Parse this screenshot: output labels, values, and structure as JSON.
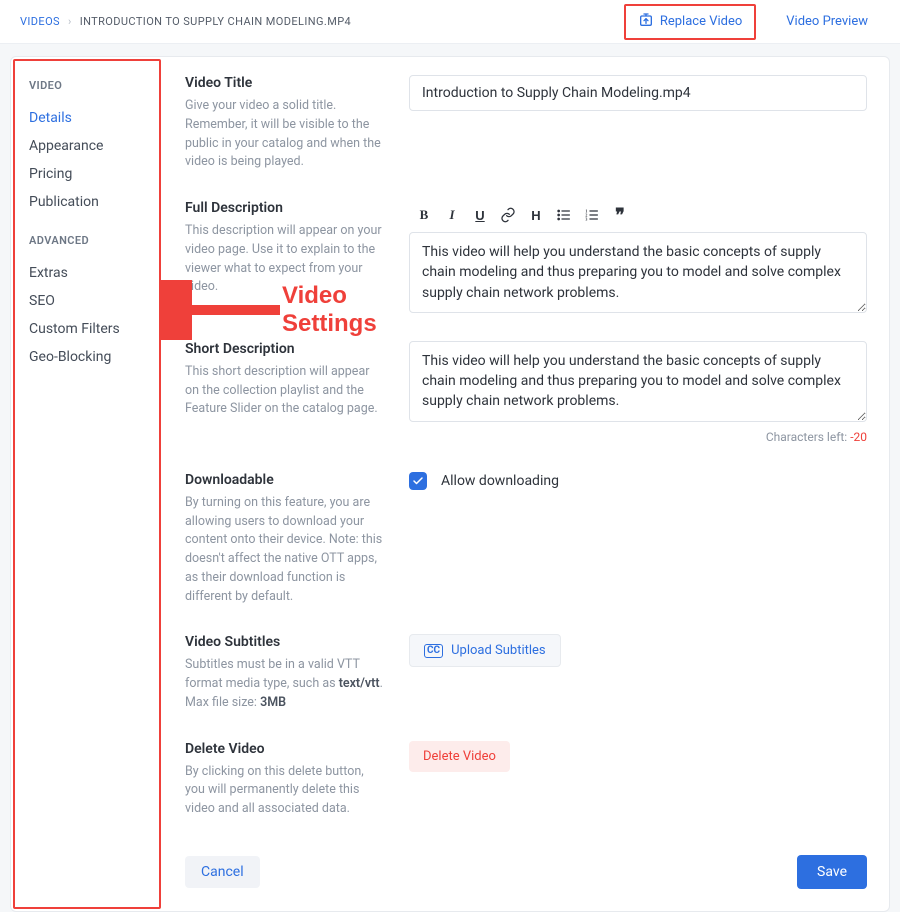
{
  "breadcrumb": {
    "root": "VIDEOS",
    "sep": "›",
    "current": "INTRODUCTION TO SUPPLY CHAIN MODELING.MP4"
  },
  "topbar": {
    "replace_label": "Replace Video",
    "preview_label": "Video Preview"
  },
  "sidebar": {
    "video_section": "VIDEO",
    "advanced_section": "ADVANCED",
    "items_video": [
      "Details",
      "Appearance",
      "Pricing",
      "Publication"
    ],
    "items_advanced": [
      "Extras",
      "SEO",
      "Custom Filters",
      "Geo-Blocking"
    ]
  },
  "annotation": {
    "label_line1": "Video",
    "label_line2": "Settings"
  },
  "fields": {
    "title": {
      "label": "Video Title",
      "desc": "Give your video a solid title. Remember, it will be visible to the public in your catalog and when the video is being played.",
      "value": "Introduction to Supply Chain Modeling.mp4"
    },
    "full_desc": {
      "label": "Full Description",
      "desc": "This description will appear on your video page. Use it to explain to the viewer what to expect from your video.",
      "value": "This video will help you understand the basic concepts of supply chain modeling and thus preparing you to model and solve complex supply chain network problems."
    },
    "short_desc": {
      "label": "Short Description",
      "desc": "This short description will appear on the collection playlist and the Feature Slider on the catalog page.",
      "value": "This video will help you understand the basic concepts of supply chain modeling and thus preparing you to model and solve complex supply chain network problems.",
      "chars_left_label": "Characters left: ",
      "chars_left_value": "-20"
    },
    "downloadable": {
      "label": "Downloadable",
      "desc": "By turning on this feature, you are allowing users to download your content onto their device. Note: this doesn't affect the native OTT apps, as their download function is different by default.",
      "checkbox_label": "Allow downloading",
      "checked": true
    },
    "subtitles": {
      "label": "Video Subtitles",
      "desc_pre": "Subtitles must be in a valid VTT format media type, such as ",
      "desc_strong1": "text/vtt",
      "desc_mid": ".",
      "desc_pre2": "Max file size: ",
      "desc_strong2": "3MB",
      "button_label": "Upload Subtitles",
      "cc_badge": "CC"
    },
    "delete": {
      "label": "Delete Video",
      "desc": "By clicking on this delete button, you will permanently delete this video and all associated data.",
      "button_label": "Delete Video"
    }
  },
  "footer": {
    "cancel": "Cancel",
    "save": "Save"
  }
}
